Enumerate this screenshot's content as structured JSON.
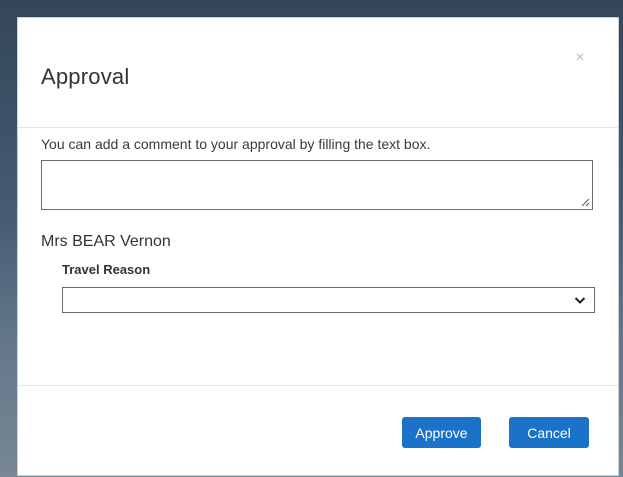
{
  "dialog": {
    "title": "Approval",
    "close_glyph": "×",
    "instruction": "You can add a comment to your approval by filling the text box.",
    "comment": {
      "value": "",
      "placeholder": ""
    },
    "traveller_name": "Mrs BEAR Vernon",
    "travel_reason": {
      "label": "Travel Reason",
      "selected": ""
    },
    "buttons": {
      "approve_label": "Approve",
      "cancel_label": "Cancel"
    }
  },
  "icons": {
    "close": "close-icon",
    "dropdown": "chevron-down-icon",
    "resize": "resize-grip-icon"
  },
  "colors": {
    "primary_button": "#1a73c8",
    "button_text": "#ffffff",
    "field_border": "#6b6b6b",
    "divider": "#e3e6e9"
  }
}
